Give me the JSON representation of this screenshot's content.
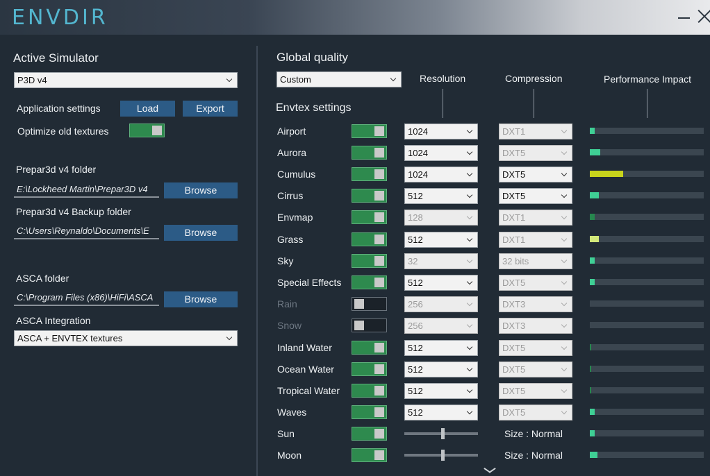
{
  "app": {
    "title": "ENVDIR"
  },
  "left": {
    "active_sim_label": "Active Simulator",
    "active_sim_value": "P3D v4",
    "app_settings_label": "Application settings",
    "load_label": "Load",
    "export_label": "Export",
    "optimize_label": "Optimize old textures",
    "optimize_on": true,
    "p3d_folder_label": "Prepar3d v4 folder",
    "p3d_folder_value": "E:\\Lockheed Martin\\Prepar3D v4",
    "backup_folder_label": "Prepar3d v4 Backup folder",
    "backup_folder_value": "C:\\Users\\Reynaldo\\Documents\\E",
    "browse_label": "Browse",
    "asca_folder_label": "ASCA folder",
    "asca_folder_value": "C:\\Program Files (x86)\\HiFi\\ASCA",
    "asca_integration_label": "ASCA Integration",
    "asca_integration_value": "ASCA + ENVTEX textures"
  },
  "right": {
    "global_quality_label": "Global quality",
    "global_quality_value": "Custom",
    "col_resolution": "Resolution",
    "col_compression": "Compression",
    "col_performance": "Performance Impact",
    "envtex_label": "Envtex settings",
    "size_prefix": "Size : ",
    "rows": [
      {
        "name": "Airport",
        "enabled": true,
        "res": "1024",
        "res_enabled": true,
        "comp": "DXT1",
        "comp_enabled": false,
        "perf": 0.04,
        "perf_color": "#3fcf95"
      },
      {
        "name": "Aurora",
        "enabled": true,
        "res": "1024",
        "res_enabled": true,
        "comp": "DXT5",
        "comp_enabled": false,
        "perf": 0.09,
        "perf_color": "#3fcf95"
      },
      {
        "name": "Cumulus",
        "enabled": true,
        "res": "1024",
        "res_enabled": true,
        "comp": "DXT5",
        "comp_enabled": true,
        "perf": 0.29,
        "perf_color": "#c8d41c"
      },
      {
        "name": "Cirrus",
        "enabled": true,
        "res": "512",
        "res_enabled": true,
        "comp": "DXT5",
        "comp_enabled": true,
        "perf": 0.08,
        "perf_color": "#3fcf95"
      },
      {
        "name": "Envmap",
        "enabled": true,
        "res": "128",
        "res_enabled": false,
        "comp": "DXT1",
        "comp_enabled": false,
        "perf": 0.04,
        "perf_color": "#26874e"
      },
      {
        "name": "Grass",
        "enabled": true,
        "res": "512",
        "res_enabled": true,
        "comp": "DXT1",
        "comp_enabled": false,
        "perf": 0.08,
        "perf_color": "#d2e87a"
      },
      {
        "name": "Sky",
        "enabled": true,
        "res": "32",
        "res_enabled": false,
        "comp": "32 bits",
        "comp_enabled": false,
        "perf": 0.04,
        "perf_color": "#3fcf95"
      },
      {
        "name": "Special Effects",
        "enabled": true,
        "res": "512",
        "res_enabled": true,
        "comp": "DXT5",
        "comp_enabled": false,
        "perf": 0.04,
        "perf_color": "#3fcf95"
      },
      {
        "name": "Rain",
        "enabled": false,
        "res": "256",
        "res_enabled": false,
        "comp": "DXT3",
        "comp_enabled": false,
        "perf": 0,
        "perf_color": "#3fcf95"
      },
      {
        "name": "Snow",
        "enabled": false,
        "res": "256",
        "res_enabled": false,
        "comp": "DXT3",
        "comp_enabled": false,
        "perf": 0,
        "perf_color": "#3fcf95"
      },
      {
        "name": "Inland Water",
        "enabled": true,
        "res": "512",
        "res_enabled": true,
        "comp": "DXT5",
        "comp_enabled": false,
        "perf": 0.01,
        "perf_color": "#26874e"
      },
      {
        "name": "Ocean Water",
        "enabled": true,
        "res": "512",
        "res_enabled": true,
        "comp": "DXT5",
        "comp_enabled": false,
        "perf": 0.01,
        "perf_color": "#26874e"
      },
      {
        "name": "Tropical Water",
        "enabled": true,
        "res": "512",
        "res_enabled": true,
        "comp": "DXT5",
        "comp_enabled": false,
        "perf": 0.01,
        "perf_color": "#26874e"
      },
      {
        "name": "Waves",
        "enabled": true,
        "res": "512",
        "res_enabled": true,
        "comp": "DXT5",
        "comp_enabled": false,
        "perf": 0.04,
        "perf_color": "#3fcf95"
      },
      {
        "name": "Sun",
        "enabled": true,
        "slider": 0.5,
        "size": "Normal",
        "perf": 0.04,
        "perf_color": "#3fcf95"
      },
      {
        "name": "Moon",
        "enabled": true,
        "slider": 0.5,
        "size": "Normal",
        "perf": 0.07,
        "perf_color": "#3fcf95"
      }
    ]
  }
}
